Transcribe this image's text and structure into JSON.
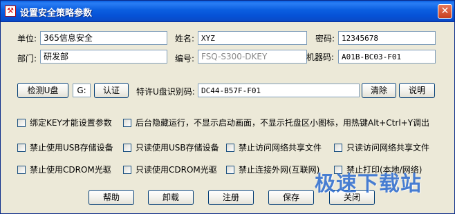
{
  "window": {
    "title": "设置安全策略参数",
    "app_icon_glyph": "⚒",
    "close_glyph": "✕"
  },
  "fields": {
    "unit_label": "单位:",
    "unit_value": "365信息安全",
    "name_label": "姓名:",
    "name_value": "XYZ",
    "password_label": "密码:",
    "password_value": "12345678",
    "dept_label": "部门:",
    "dept_value": "研发部",
    "serial_label": "编号:",
    "serial_value": "FSQ-S300-DKEY",
    "machine_label": "机器码:",
    "machine_value": "A01B-BC03-F01"
  },
  "usb_row": {
    "detect_button": "检测U盘",
    "drive_value": "G:",
    "auth_button": "认证",
    "allowed_label": "特许U盘识别码:",
    "allowed_value": "DC44-B57F-F01",
    "clear_button": "清除",
    "help_button": "说明"
  },
  "options": [
    {
      "label": "绑定KEY才能设置参数"
    },
    {
      "label": "后台隐藏运行，不显示启动画面，不显示托盘区小图标，用热键Alt+Ctrl+Y调出"
    },
    {
      "label": "禁止使用USB存储设备"
    },
    {
      "label": "只读使用USB存储设备"
    },
    {
      "label": "禁止访问网络共享文件"
    },
    {
      "label": "只读访问网络共享文件"
    },
    {
      "label": "禁止使用CDROM光驱"
    },
    {
      "label": "只读使用CDROM光驱"
    },
    {
      "label": "禁止连接外网(互联网)"
    },
    {
      "label": "禁止打印(本地/网络)"
    }
  ],
  "footer": {
    "help": "帮助",
    "uninstall": "卸载",
    "register": "注册",
    "save": "保存",
    "close": "关闭"
  },
  "watermark": "极速下载站",
  "colors": {
    "titlebar": "#0a5fe0",
    "dialog_bg": "#ece9d8",
    "close_button": "#d5512f",
    "watermark": "#2b6bd0"
  }
}
